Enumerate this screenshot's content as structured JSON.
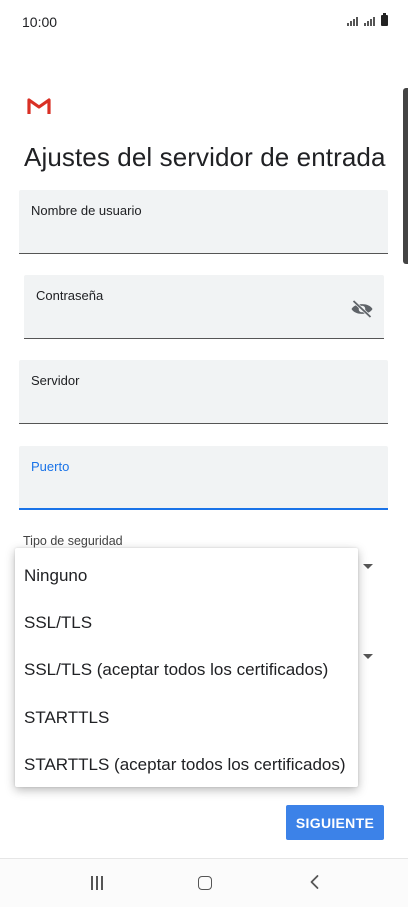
{
  "status_bar": {
    "time": "10:00"
  },
  "page": {
    "title": "Ajustes del servidor de entrada"
  },
  "fields": {
    "username": {
      "label": "Nombre de usuario",
      "value": ""
    },
    "password": {
      "label": "Contraseña",
      "value": ""
    },
    "server": {
      "label": "Servidor",
      "value": ""
    },
    "port": {
      "label": "Puerto",
      "value": ""
    }
  },
  "security": {
    "label": "Tipo de seguridad",
    "options": [
      "Ninguno",
      "SSL/TLS",
      "SSL/TLS (aceptar todos los certificados)",
      "STARTTLS",
      "STARTTLS (aceptar todos los certificados)"
    ]
  },
  "actions": {
    "next_label": "SIGUIENTE"
  },
  "colors": {
    "accent": "#1a73e8",
    "button": "#3c82e8",
    "gmail_red": "#d93025"
  },
  "icons": [
    "gmail-logo-icon",
    "visibility-off-icon",
    "dropdown-caret-icon",
    "recent-apps-icon",
    "home-icon",
    "back-icon"
  ]
}
